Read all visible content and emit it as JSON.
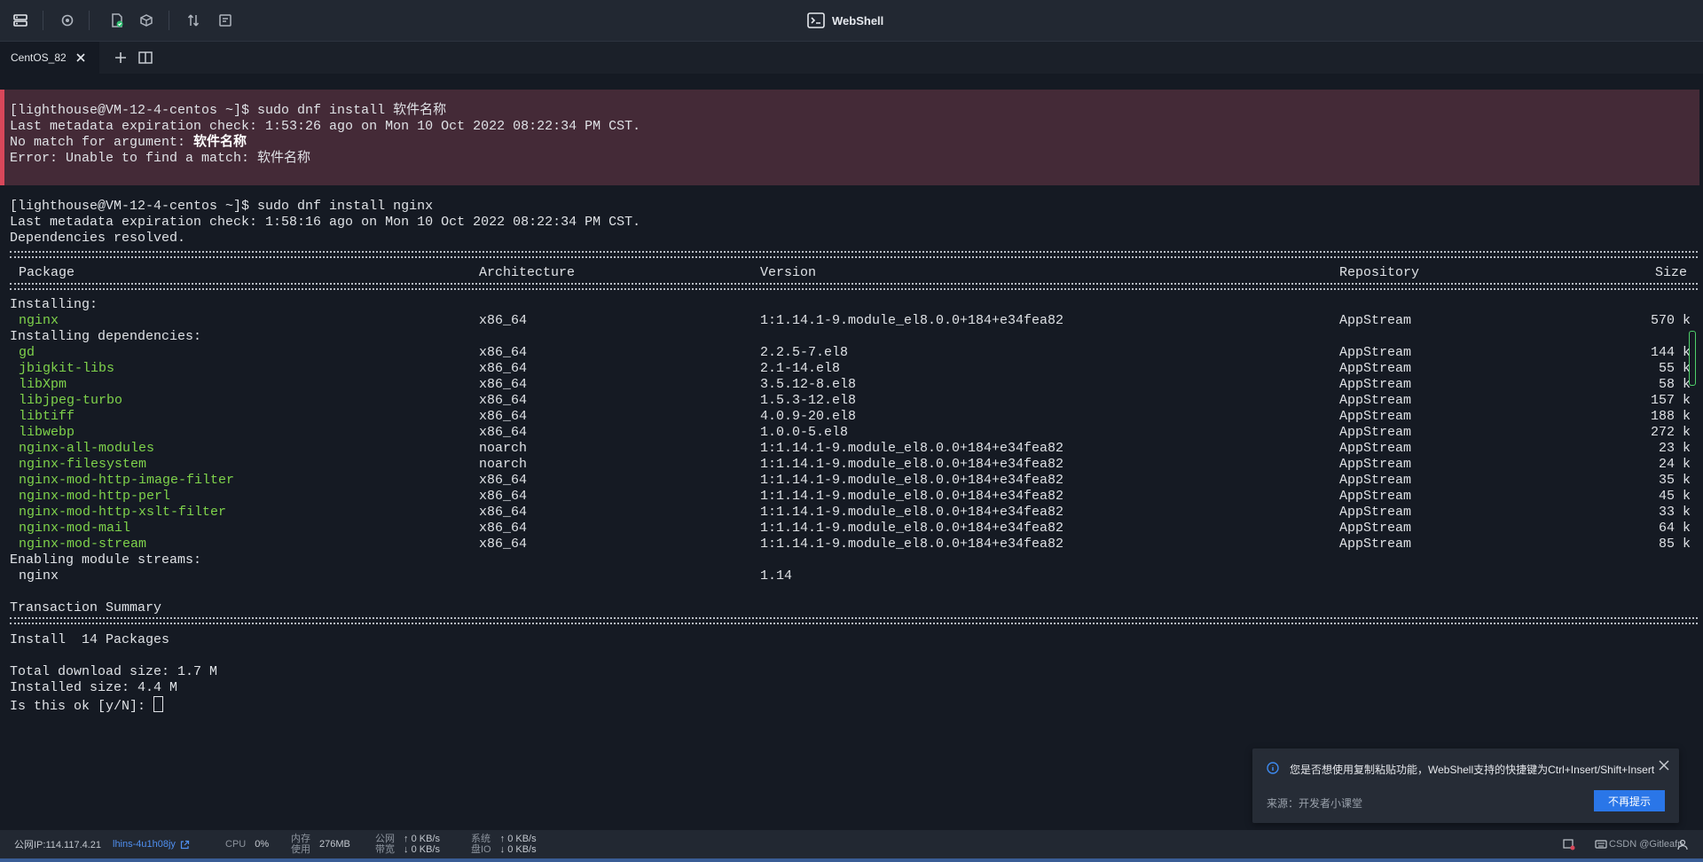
{
  "app": {
    "title": "WebShell"
  },
  "tabs": [
    {
      "label": "CentOS_82"
    }
  ],
  "terminal": {
    "error_block": [
      "[lighthouse@VM-12-4-centos ~]$ sudo dnf install 软件名称",
      "Last metadata expiration check: 1:53:26 ago on Mon 10 Oct 2022 08:22:34 PM CST.",
      "No match for argument: ",
      "软件名称",
      "Error: Unable to find a match: 软件名称"
    ],
    "lines_before_table": [
      "[lighthouse@VM-12-4-centos ~]$ sudo dnf install nginx",
      "Last metadata expiration check: 1:58:16 ago on Mon 10 Oct 2022 08:22:34 PM CST.",
      "Dependencies resolved."
    ],
    "table_headers": [
      "Package",
      "Architecture",
      "Version",
      "Repository",
      "Size"
    ],
    "section_installing": "Installing:",
    "main_package": {
      "name": "nginx",
      "arch": "x86_64",
      "version": "1:1.14.1-9.module_el8.0.0+184+e34fea82",
      "repo": "AppStream",
      "size": "570 k"
    },
    "section_deps": "Installing dependencies:",
    "dependencies": [
      {
        "name": "gd",
        "arch": "x86_64",
        "version": "2.2.5-7.el8",
        "repo": "AppStream",
        "size": "144 k"
      },
      {
        "name": "jbigkit-libs",
        "arch": "x86_64",
        "version": "2.1-14.el8",
        "repo": "AppStream",
        "size": "55 k"
      },
      {
        "name": "libXpm",
        "arch": "x86_64",
        "version": "3.5.12-8.el8",
        "repo": "AppStream",
        "size": "58 k"
      },
      {
        "name": "libjpeg-turbo",
        "arch": "x86_64",
        "version": "1.5.3-12.el8",
        "repo": "AppStream",
        "size": "157 k"
      },
      {
        "name": "libtiff",
        "arch": "x86_64",
        "version": "4.0.9-20.el8",
        "repo": "AppStream",
        "size": "188 k"
      },
      {
        "name": "libwebp",
        "arch": "x86_64",
        "version": "1.0.0-5.el8",
        "repo": "AppStream",
        "size": "272 k"
      },
      {
        "name": "nginx-all-modules",
        "arch": "noarch",
        "version": "1:1.14.1-9.module_el8.0.0+184+e34fea82",
        "repo": "AppStream",
        "size": "23 k"
      },
      {
        "name": "nginx-filesystem",
        "arch": "noarch",
        "version": "1:1.14.1-9.module_el8.0.0+184+e34fea82",
        "repo": "AppStream",
        "size": "24 k"
      },
      {
        "name": "nginx-mod-http-image-filter",
        "arch": "x86_64",
        "version": "1:1.14.1-9.module_el8.0.0+184+e34fea82",
        "repo": "AppStream",
        "size": "35 k"
      },
      {
        "name": "nginx-mod-http-perl",
        "arch": "x86_64",
        "version": "1:1.14.1-9.module_el8.0.0+184+e34fea82",
        "repo": "AppStream",
        "size": "45 k"
      },
      {
        "name": "nginx-mod-http-xslt-filter",
        "arch": "x86_64",
        "version": "1:1.14.1-9.module_el8.0.0+184+e34fea82",
        "repo": "AppStream",
        "size": "33 k"
      },
      {
        "name": "nginx-mod-mail",
        "arch": "x86_64",
        "version": "1:1.14.1-9.module_el8.0.0+184+e34fea82",
        "repo": "AppStream",
        "size": "64 k"
      },
      {
        "name": "nginx-mod-stream",
        "arch": "x86_64",
        "version": "1:1.14.1-9.module_el8.0.0+184+e34fea82",
        "repo": "AppStream",
        "size": "85 k"
      }
    ],
    "section_modules": "Enabling module streams:",
    "module_stream": {
      "name": "nginx",
      "version": "1.14"
    },
    "transaction_summary": "Transaction Summary",
    "install_count": "Install  14 Packages",
    "download_size": "Total download size: 1.7 M",
    "installed_size": "Installed size: 4.4 M",
    "prompt": "Is this ok [y/N]: "
  },
  "notice": {
    "message": "您是否想使用复制粘贴功能，WebShell支持的快捷键为Ctrl+Insert/Shift+Insert",
    "source": "来源：开发者小课堂",
    "button": "不再提示"
  },
  "statusbar": {
    "public_ip": "公网IP:114.117.4.21",
    "instance_id": "lhins-4u1h08jy",
    "cpu_label": "CPU",
    "cpu_value": "0%",
    "mem_label_1": "内存",
    "mem_label_2": "使用",
    "mem_value": "276MB",
    "net_label_1": "公网",
    "net_label_2": "带宽",
    "net_up": "0 KB/s",
    "net_down": "0 KB/s",
    "disk_label_1": "系统",
    "disk_label_2": "盘IO",
    "disk_up": "0 KB/s",
    "disk_down": "0 KB/s",
    "watermark": "CSDN @Gitleafp"
  },
  "colors": {
    "terminal_bg": "#151a23",
    "error_bg": "#442a37",
    "error_border": "#d8475a",
    "package_green": "#7fd34b",
    "accent_blue": "#2a76e8"
  }
}
